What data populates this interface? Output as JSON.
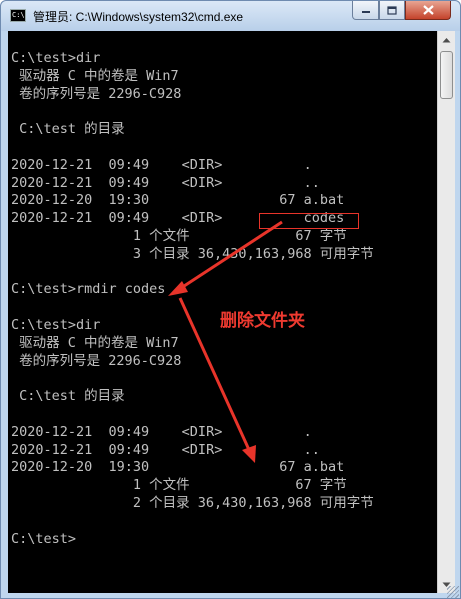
{
  "window": {
    "title": "管理员: C:\\Windows\\system32\\cmd.exe",
    "app_icon_text": "C:\\"
  },
  "controls": {
    "minimize_icon": "minimize-icon",
    "maximize_icon": "maximize-icon",
    "close_icon": "close-icon"
  },
  "console": {
    "lines": [
      "C:\\test>dir",
      " 驱动器 C 中的卷是 Win7",
      " 卷的序列号是 2296-C928",
      "",
      " C:\\test 的目录",
      "",
      "2020-12-21  09:49    <DIR>          .",
      "2020-12-21  09:49    <DIR>          ..",
      "2020-12-20  19:30                67 a.bat",
      "2020-12-21  09:49    <DIR>          codes",
      "               1 个文件             67 字节",
      "               3 个目录 36,430,163,968 可用字节",
      "",
      "C:\\test>rmdir codes",
      "",
      "C:\\test>dir",
      " 驱动器 C 中的卷是 Win7",
      " 卷的序列号是 2296-C928",
      "",
      " C:\\test 的目录",
      "",
      "2020-12-21  09:49    <DIR>          .",
      "2020-12-21  09:49    <DIR>          ..",
      "2020-12-20  19:30                67 a.bat",
      "               1 个文件             67 字节",
      "               2 个目录 36,430,163,968 可用字节",
      "",
      "C:\\test>"
    ]
  },
  "annotation": {
    "label": "删除文件夹",
    "color": "#e8342a"
  },
  "colors": {
    "console_bg": "#000000",
    "console_fg": "#c0c0c0",
    "titlebar": "#bfd6ee",
    "close_button": "#c4432b"
  }
}
